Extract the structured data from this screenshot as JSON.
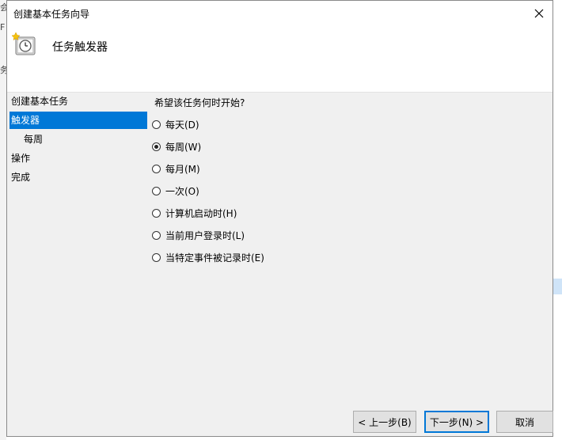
{
  "background": {
    "left_fragments": [
      "会",
      "F",
      "务"
    ]
  },
  "dialog": {
    "title": "创建基本任务向导",
    "close_symbol": "✕",
    "header_title": "任务触发器"
  },
  "nav": {
    "items": [
      {
        "label": "创建基本任务",
        "sub": false,
        "selected": false
      },
      {
        "label": "触发器",
        "sub": false,
        "selected": true
      },
      {
        "label": "每周",
        "sub": true,
        "selected": false
      },
      {
        "label": "操作",
        "sub": false,
        "selected": false
      },
      {
        "label": "完成",
        "sub": false,
        "selected": false
      }
    ]
  },
  "content": {
    "question": "希望该任务何时开始?",
    "options": [
      {
        "label": "每天(D)",
        "checked": false
      },
      {
        "label": "每周(W)",
        "checked": true
      },
      {
        "label": "每月(M)",
        "checked": false
      },
      {
        "label": "一次(O)",
        "checked": false
      },
      {
        "label": "计算机启动时(H)",
        "checked": false
      },
      {
        "label": "当前用户登录时(L)",
        "checked": false
      },
      {
        "label": "当特定事件被记录时(E)",
        "checked": false
      }
    ]
  },
  "buttons": {
    "back": "< 上一步(B)",
    "next": "下一步(N) >",
    "cancel": "取消"
  },
  "colors": {
    "selection": "#0078d7"
  }
}
